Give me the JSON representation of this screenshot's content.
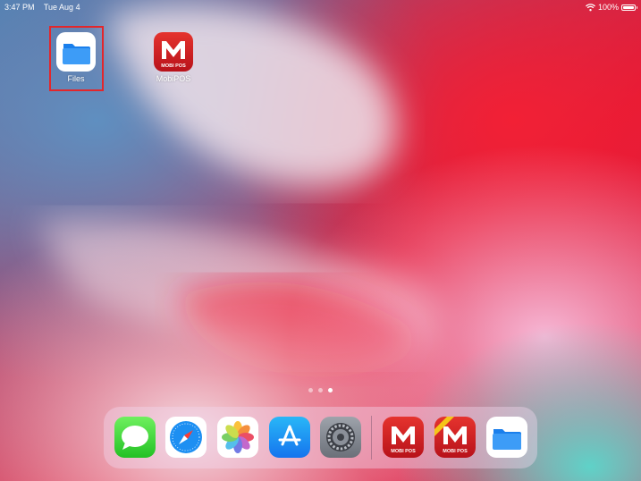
{
  "status_bar": {
    "time": "3:47 PM",
    "date": "Tue Aug 4",
    "battery_percent": "100%",
    "battery_level": 1.0
  },
  "home_apps": [
    {
      "label": "Files",
      "icon": "files-folder-icon",
      "highlighted": true
    },
    {
      "label": "MobiPOS",
      "icon": "mobipos-icon",
      "icon_text": "MOBI POS"
    }
  ],
  "page_indicator": {
    "pages": 3,
    "current": 3
  },
  "dock": {
    "apps": [
      {
        "name": "Messages",
        "icon": "messages-icon"
      },
      {
        "name": "Safari",
        "icon": "safari-icon"
      },
      {
        "name": "Photos",
        "icon": "photos-icon"
      },
      {
        "name": "App Store",
        "icon": "app-store-icon"
      },
      {
        "name": "Settings",
        "icon": "settings-icon"
      },
      {
        "name": "MobiPOS",
        "icon": "mobipos-icon",
        "icon_text": "MOBI POS"
      },
      {
        "name": "MobiPOS",
        "icon": "mobipos-icon",
        "icon_text": "MOBI POS"
      },
      {
        "name": "Files",
        "icon": "files-folder-icon"
      }
    ]
  },
  "colors": {
    "highlight_box": "#e3262b",
    "mobipos_red": "#d62229",
    "files_blue": "#2f8ff5"
  }
}
